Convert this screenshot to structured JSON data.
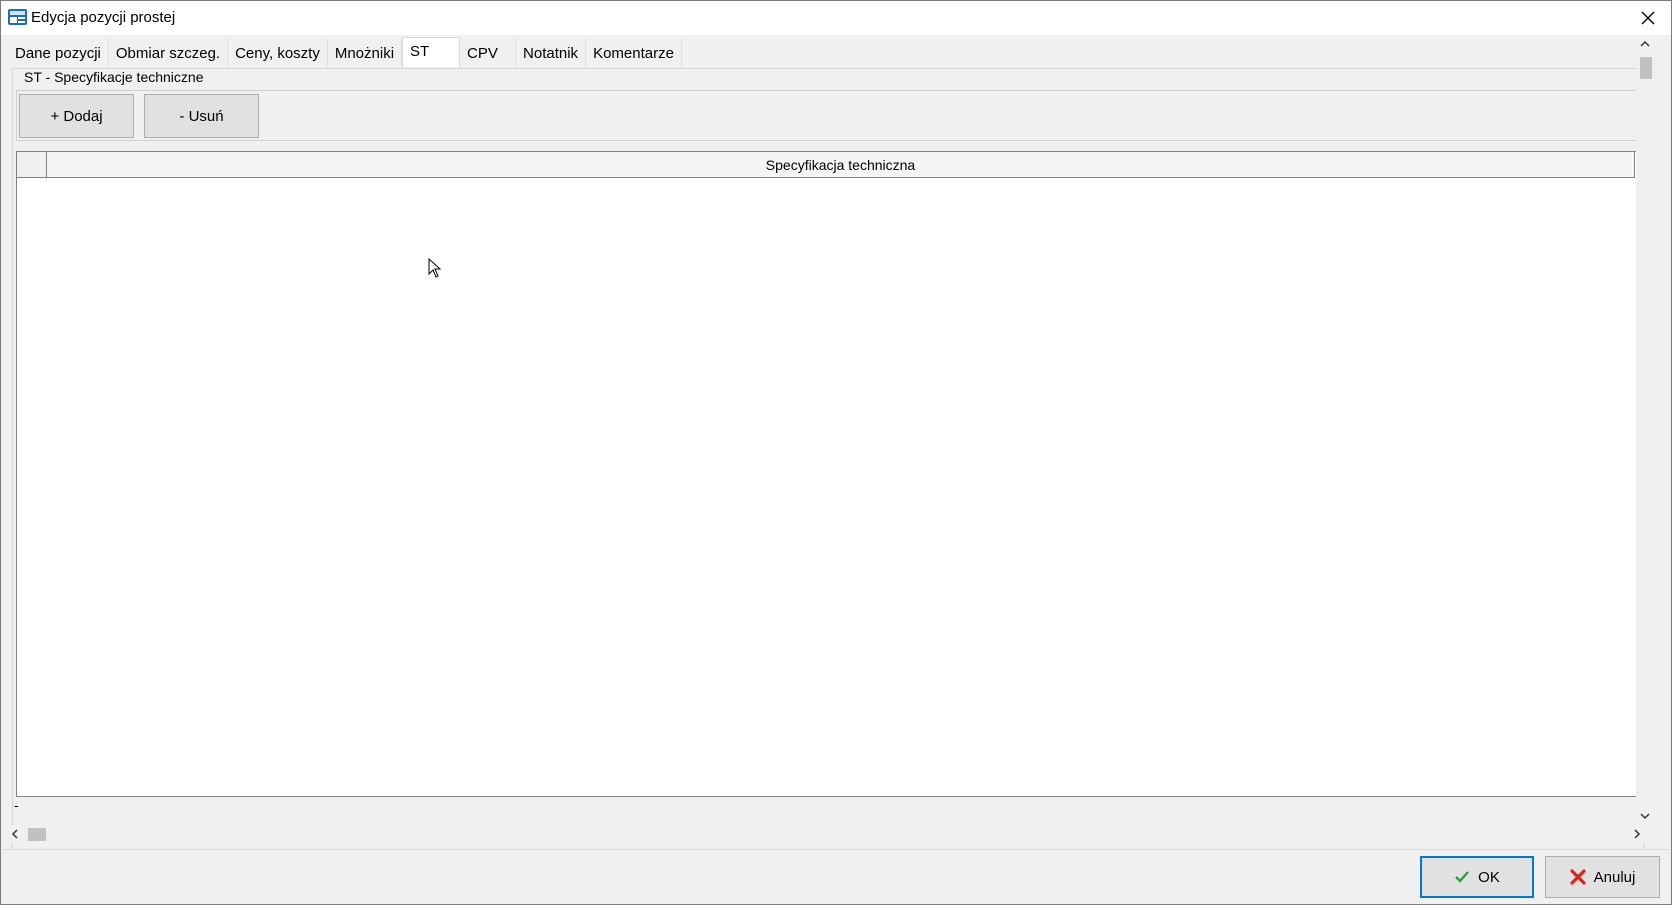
{
  "window": {
    "title": "Edycja pozycji prostej"
  },
  "tabs": [
    {
      "label": "Dane pozycji",
      "active": false
    },
    {
      "label": "Obmiar szczeg.",
      "active": false
    },
    {
      "label": "Ceny, koszty",
      "active": false
    },
    {
      "label": "Mnożniki",
      "active": false
    },
    {
      "label": "ST",
      "active": true
    },
    {
      "label": "CPV",
      "active": false
    },
    {
      "label": "Notatnik",
      "active": false
    },
    {
      "label": "Komentarze",
      "active": false
    }
  ],
  "group": {
    "title": "ST - Specyfikacje techniczne"
  },
  "toolbar": {
    "add_label": "+ Dodaj",
    "remove_label": "- Usuń"
  },
  "grid": {
    "columns": [
      "Specyfikacja techniczna"
    ],
    "rows": []
  },
  "status": {
    "text": "-"
  },
  "footer": {
    "ok_label": "OK",
    "cancel_label": "Anuluj"
  },
  "colors": {
    "ok_check": "#2e9d3a",
    "cancel_x": "#d9241c",
    "default_border": "#0078d7"
  },
  "icons": {
    "app": "app-icon",
    "close": "close-icon",
    "ok": "checkmark-icon",
    "cancel": "red-x-icon"
  }
}
